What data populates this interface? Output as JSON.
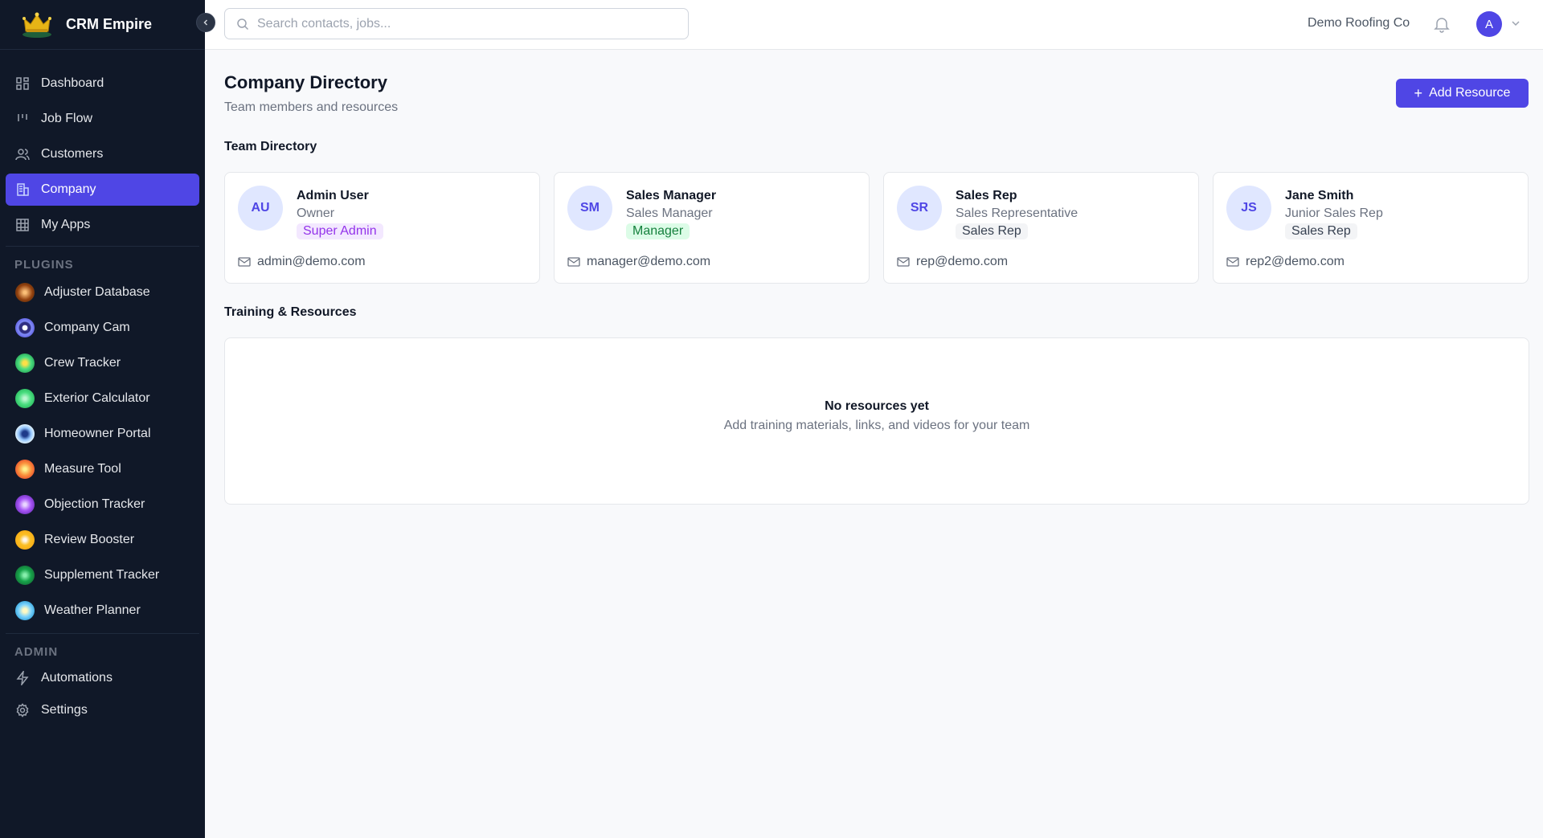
{
  "brand": {
    "name": "CRM Empire",
    "logo": "crown-logo"
  },
  "sidebar": {
    "nav": [
      {
        "label": "Dashboard",
        "icon": "grid-icon"
      },
      {
        "label": "Job Flow",
        "icon": "kanban-icon"
      },
      {
        "label": "Customers",
        "icon": "users-icon"
      },
      {
        "label": "Company",
        "icon": "building-icon",
        "active": true
      },
      {
        "label": "My Apps",
        "icon": "apps-icon"
      }
    ],
    "plugins_label": "PLUGINS",
    "plugins": [
      {
        "label": "Adjuster Database",
        "color": "#c2410c"
      },
      {
        "label": "Company Cam",
        "color": "#6366f1"
      },
      {
        "label": "Crew Tracker",
        "color": "#22c55e"
      },
      {
        "label": "Exterior Calculator",
        "color": "#22c55e"
      },
      {
        "label": "Homeowner Portal",
        "color": "#3b82f6"
      },
      {
        "label": "Measure Tool",
        "color": "#f97316"
      },
      {
        "label": "Objection Tracker",
        "color": "#8b5cf6"
      },
      {
        "label": "Review Booster",
        "color": "#f59e0b"
      },
      {
        "label": "Supplement Tracker",
        "color": "#16a34a"
      },
      {
        "label": "Weather Planner",
        "color": "#38bdf8"
      }
    ],
    "admin_label": "ADMIN",
    "admin": [
      {
        "label": "Automations",
        "icon": "bolt-icon"
      },
      {
        "label": "Settings",
        "icon": "gear-icon"
      }
    ]
  },
  "topbar": {
    "search_placeholder": "Search contacts, jobs...",
    "company": "Demo Roofing Co",
    "avatar_initial": "A"
  },
  "page": {
    "title": "Company Directory",
    "subtitle": "Team members and resources",
    "add_button": "Add Resource",
    "team_section": "Team Directory",
    "resources_section": "Training & Resources"
  },
  "team": [
    {
      "initials": "AU",
      "name": "Admin User",
      "title": "Owner",
      "badge": "Super Admin",
      "badge_color": "#9333ea",
      "badge_bg": "#f3e8ff",
      "email": "admin@demo.com"
    },
    {
      "initials": "SM",
      "name": "Sales Manager",
      "title": "Sales Manager",
      "badge": "Manager",
      "badge_color": "#15803d",
      "badge_bg": "#dcfce7",
      "email": "manager@demo.com"
    },
    {
      "initials": "SR",
      "name": "Sales Rep",
      "title": "Sales Representative",
      "badge": "Sales Rep",
      "badge_color": "#374151",
      "badge_bg": "#f3f4f6",
      "email": "rep@demo.com"
    },
    {
      "initials": "JS",
      "name": "Jane Smith",
      "title": "Junior Sales Rep",
      "badge": "Sales Rep",
      "badge_color": "#374151",
      "badge_bg": "#f3f4f6",
      "email": "rep2@demo.com"
    }
  ],
  "resources": {
    "empty_title": "No resources yet",
    "empty_text": "Add training materials, links, and videos for your team"
  }
}
